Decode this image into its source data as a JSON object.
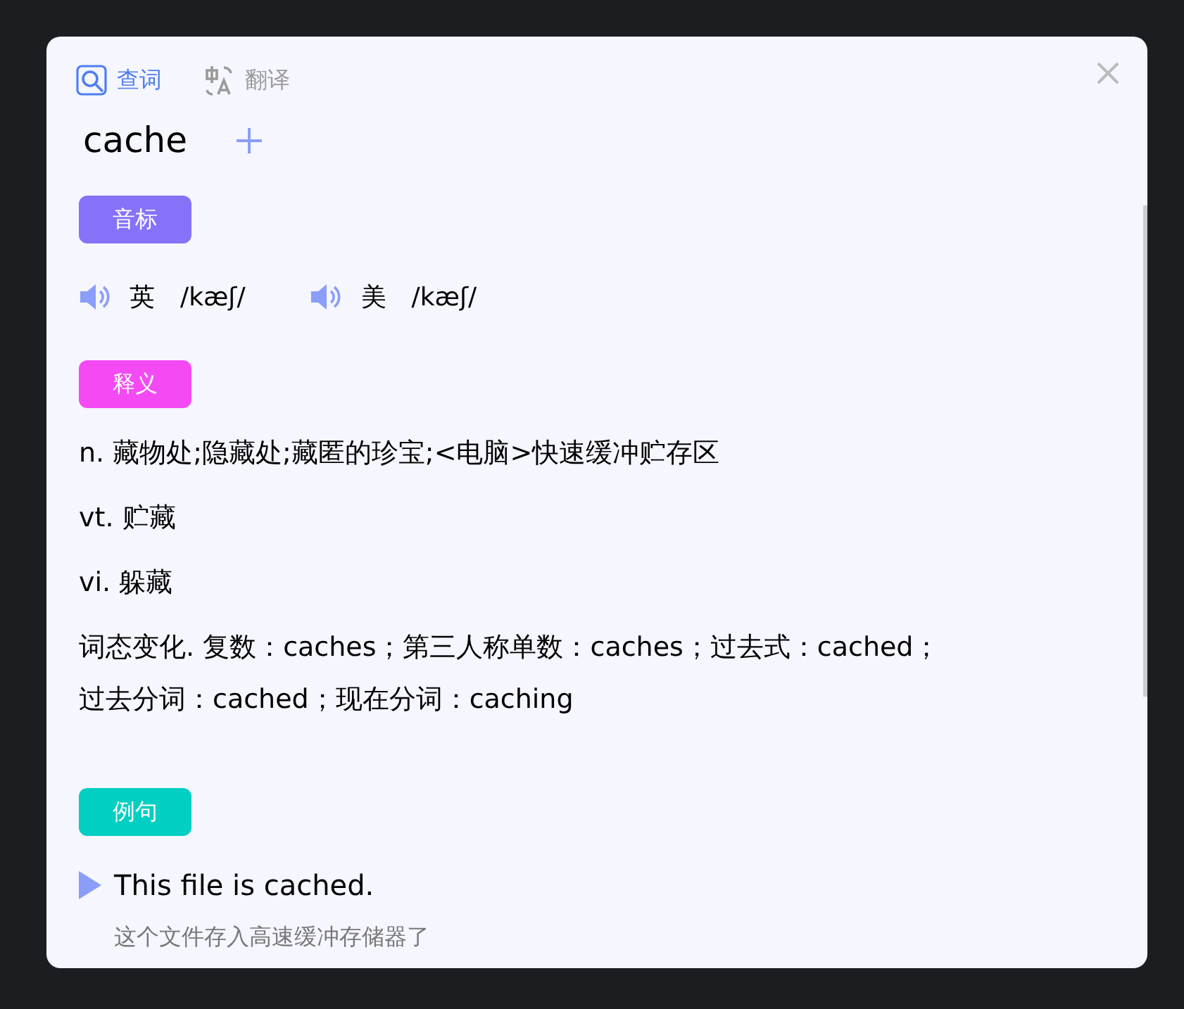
{
  "tabs": [
    {
      "label": "查词",
      "selected": true
    },
    {
      "label": "翻译",
      "selected": false
    }
  ],
  "word": "cache",
  "sections": [
    {
      "kind": "phonetics",
      "label": "音标",
      "color": "#8672f8",
      "items": [
        {
          "region": "英",
          "ipa": "/kæʃ/"
        },
        {
          "region": "美",
          "ipa": "/kæʃ/"
        }
      ]
    },
    {
      "kind": "definitions",
      "label": "释义",
      "color": "#f44af4",
      "items": [
        "n. 藏物处;隐藏处;藏匿的珍宝;<电脑>快速缓冲贮存区",
        "vt. 贮藏",
        "vi. 躲藏",
        "词态变化. 复数：caches；第三人称单数：caches；过去式：cached；过去分词：cached；现在分词：caching"
      ]
    },
    {
      "kind": "examples",
      "label": "例句",
      "color": "#00cfc2",
      "items": [
        {
          "sentence": "This file is cached.",
          "translation": "这个文件存入高速缓冲存储器了"
        }
      ]
    }
  ]
}
